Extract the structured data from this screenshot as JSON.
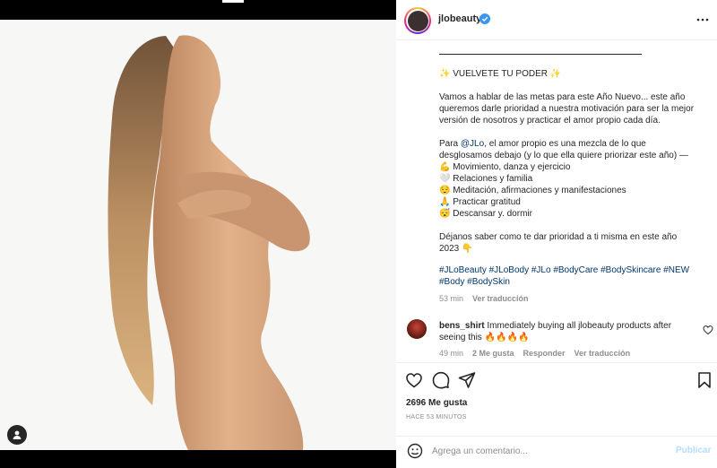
{
  "post": {
    "username": "jlobeauty",
    "verified": true
  },
  "caption": {
    "divider": "____________________________________",
    "title": "✨ VUELVETE TU PODER ✨",
    "para1": [
      "Vamos a hablar de las metas para este Año Nuevo... este año",
      "queremos darle prioridad a nuestra motivación para ser la mejor",
      "versión de nosotros y practicar el amor propio cada día."
    ],
    "para2_prefix": "Para ",
    "para2_mention": "@JLo",
    "para2_rest": ", el amor propio es una mezcla de lo que",
    "para2_lines": [
      "desglosamos debajo (y lo que ella quiere priorizar este año) —"
    ],
    "list": [
      "💪 Movimiento, danza y ejercicio",
      "🤍 Relaciones y familia",
      "😌 Meditación, afirmaciones y manifestaciones",
      "🙏 Practicar gratitud",
      "😴 Descansar y. dormir"
    ],
    "para3": [
      "Déjanos saber como te dar prioridad a ti misma en este año",
      "2023 👇"
    ],
    "hashtags": "#JLoBeauty #JLoBody #JLo #BodyCare #BodySkincare #NEW #Body #BodySkin",
    "time": "53 min",
    "see_translation": "Ver traducción"
  },
  "comment": {
    "username": "bens_shirt",
    "text": "Immediately buying all jlobeauty products after seeing this 🔥🔥🔥🔥",
    "time": "49 min",
    "likes": "2 Me gusta",
    "reply": "Responder",
    "see_translation": "Ver traducción"
  },
  "stats": {
    "likes": "2696 Me gusta",
    "time_ago": "HACE 53 MINUTOS"
  },
  "input": {
    "placeholder": "Agrega un comentario...",
    "publish": "Publicar"
  },
  "colors": {
    "link": "#00376b",
    "muted": "#8e8e8e",
    "publish_disabled": "#b2dffc",
    "verified": "#3897f0"
  },
  "icons": [
    "verified-icon",
    "more-icon",
    "heart-icon",
    "comment-icon",
    "share-icon",
    "bookmark-icon",
    "emoji-icon",
    "user-tag-icon"
  ]
}
